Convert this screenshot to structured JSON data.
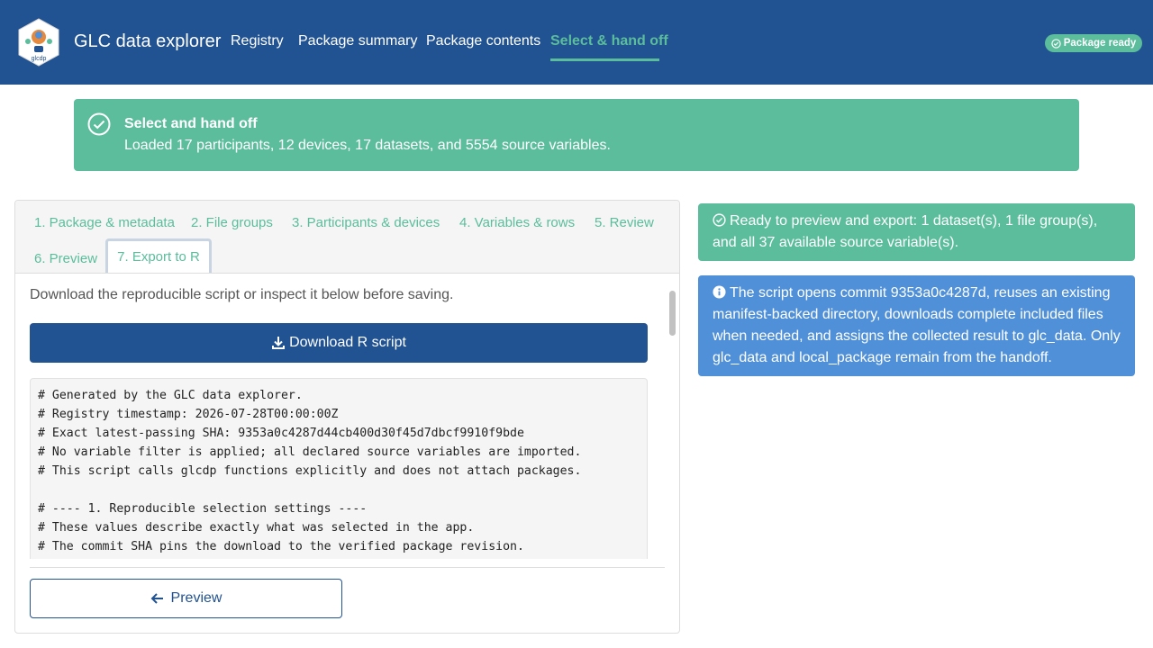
{
  "header": {
    "brand": "GLC data explorer",
    "logo_text": "glcdp",
    "nav": [
      {
        "label": "Registry"
      },
      {
        "label": "Package summary"
      },
      {
        "label": "Package contents"
      },
      {
        "label": "Select & hand off"
      }
    ],
    "status_pill": "Package ready",
    "colors": {
      "navbar": "#215291",
      "accent": "#5bbd9c"
    }
  },
  "banner": {
    "title": "Select and hand off",
    "text": "Loaded 17 participants, 12 devices, 17 datasets, and 5554 source variables."
  },
  "wizard": {
    "tabs": [
      {
        "label": "1. Package & metadata"
      },
      {
        "label": "2. File groups"
      },
      {
        "label": "3. Participants & devices"
      },
      {
        "label": "4. Variables & rows"
      },
      {
        "label": "5. Review"
      },
      {
        "label": "6. Preview"
      },
      {
        "label": "7. Export to R"
      }
    ],
    "active_tab": "7. Export to R",
    "lead": "Download the reproducible script or inspect it below before saving.",
    "download_label": "Download R script",
    "code_lines": [
      "# Generated by the GLC data explorer.",
      "# Registry timestamp: 2026-07-28T00:00:00Z",
      "# Exact latest-passing SHA: 9353a0c4287d44cb400d30f45d7dbcf9910f9bde",
      "# No variable filter is applied; all declared source variables are imported.",
      "# This script calls glcdp functions explicitly and does not attach packages.",
      "",
      "# ---- 1. Reproducible selection settings ----",
      "# These values describe exactly what was selected in the app.",
      "# The commit SHA pins the download to the verified package revision."
    ],
    "back_label": "Preview"
  },
  "side": {
    "ready_text": "Ready to preview and export: 1 dataset(s), 1 file group(s), and all 37 available source variable(s).",
    "info_text": "The script opens commit 9353a0c4287d, reuses an existing manifest-backed directory, downloads complete included files when needed, and assigns the collected result to glc_data. Only glc_data and local_package remain from the handoff."
  }
}
